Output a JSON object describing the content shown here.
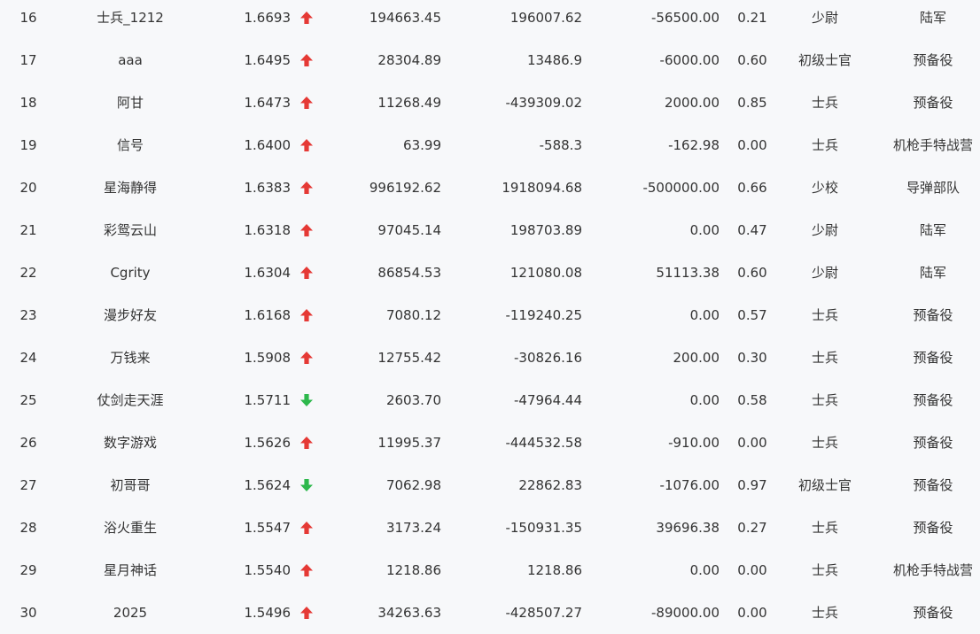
{
  "colors": {
    "background": "#f7f8fa",
    "text": "#333333",
    "trend_up": "#e53935",
    "trend_down": "#2db84c"
  },
  "rows": [
    {
      "rank": "16",
      "name": "士兵_1212",
      "score": "1.6693",
      "trend": "up",
      "value1": "194663.45",
      "value2": "196007.62",
      "value3": "-56500.00",
      "ratio": "0.21",
      "military_rank": "少尉",
      "unit": "陆军"
    },
    {
      "rank": "17",
      "name": "aaa",
      "score": "1.6495",
      "trend": "up",
      "value1": "28304.89",
      "value2": "13486.9",
      "value3": "-6000.00",
      "ratio": "0.60",
      "military_rank": "初级士官",
      "unit": "预备役"
    },
    {
      "rank": "18",
      "name": "阿甘",
      "score": "1.6473",
      "trend": "up",
      "value1": "11268.49",
      "value2": "-439309.02",
      "value3": "2000.00",
      "ratio": "0.85",
      "military_rank": "士兵",
      "unit": "预备役"
    },
    {
      "rank": "19",
      "name": "信号",
      "score": "1.6400",
      "trend": "up",
      "value1": "63.99",
      "value2": "-588.3",
      "value3": "-162.98",
      "ratio": "0.00",
      "military_rank": "士兵",
      "unit": "机枪手特战营"
    },
    {
      "rank": "20",
      "name": "星海静得",
      "score": "1.6383",
      "trend": "up",
      "value1": "996192.62",
      "value2": "1918094.68",
      "value3": "-500000.00",
      "ratio": "0.66",
      "military_rank": "少校",
      "unit": "导弹部队"
    },
    {
      "rank": "21",
      "name": "彩鸳云山",
      "score": "1.6318",
      "trend": "up",
      "value1": "97045.14",
      "value2": "198703.89",
      "value3": "0.00",
      "ratio": "0.47",
      "military_rank": "少尉",
      "unit": "陆军"
    },
    {
      "rank": "22",
      "name": "Cgrity",
      "score": "1.6304",
      "trend": "up",
      "value1": "86854.53",
      "value2": "121080.08",
      "value3": "51113.38",
      "ratio": "0.60",
      "military_rank": "少尉",
      "unit": "陆军"
    },
    {
      "rank": "23",
      "name": "漫步好友",
      "score": "1.6168",
      "trend": "up",
      "value1": "7080.12",
      "value2": "-119240.25",
      "value3": "0.00",
      "ratio": "0.57",
      "military_rank": "士兵",
      "unit": "预备役"
    },
    {
      "rank": "24",
      "name": "万钱来",
      "score": "1.5908",
      "trend": "up",
      "value1": "12755.42",
      "value2": "-30826.16",
      "value3": "200.00",
      "ratio": "0.30",
      "military_rank": "士兵",
      "unit": "预备役"
    },
    {
      "rank": "25",
      "name": "仗剑走天涯",
      "score": "1.5711",
      "trend": "down",
      "value1": "2603.70",
      "value2": "-47964.44",
      "value3": "0.00",
      "ratio": "0.58",
      "military_rank": "士兵",
      "unit": "预备役"
    },
    {
      "rank": "26",
      "name": "数字游戏",
      "score": "1.5626",
      "trend": "up",
      "value1": "11995.37",
      "value2": "-444532.58",
      "value3": "-910.00",
      "ratio": "0.00",
      "military_rank": "士兵",
      "unit": "预备役"
    },
    {
      "rank": "27",
      "name": "初哥哥",
      "score": "1.5624",
      "trend": "down",
      "value1": "7062.98",
      "value2": "22862.83",
      "value3": "-1076.00",
      "ratio": "0.97",
      "military_rank": "初级士官",
      "unit": "预备役"
    },
    {
      "rank": "28",
      "name": "浴火重生",
      "score": "1.5547",
      "trend": "up",
      "value1": "3173.24",
      "value2": "-150931.35",
      "value3": "39696.38",
      "ratio": "0.27",
      "military_rank": "士兵",
      "unit": "预备役"
    },
    {
      "rank": "29",
      "name": "星月神话",
      "score": "1.5540",
      "trend": "up",
      "value1": "1218.86",
      "value2": "1218.86",
      "value3": "0.00",
      "ratio": "0.00",
      "military_rank": "士兵",
      "unit": "机枪手特战营"
    },
    {
      "rank": "30",
      "name": "2025",
      "score": "1.5496",
      "trend": "up",
      "value1": "34263.63",
      "value2": "-428507.27",
      "value3": "-89000.00",
      "ratio": "0.00",
      "military_rank": "士兵",
      "unit": "预备役"
    }
  ]
}
